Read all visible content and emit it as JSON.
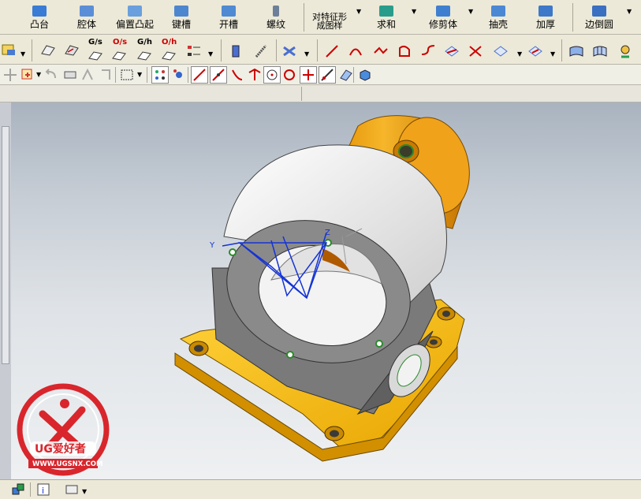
{
  "toolbar_main": {
    "buttons": [
      {
        "label": "凸台",
        "color": "#3a7bd5"
      },
      {
        "label": "腔体",
        "color": "#5a8fd8"
      },
      {
        "label": "偏置凸起",
        "color": "#6aa0de"
      },
      {
        "label": "键槽",
        "color": "#4c86cf"
      },
      {
        "label": "开槽",
        "color": "#4f8ad2"
      },
      {
        "label": "螺纹",
        "color": "#6d7f99"
      },
      {
        "label": "对特征形\n成图样",
        "color": "#2d8a3e"
      },
      {
        "label": "求和",
        "color": "#2a9c8c"
      },
      {
        "label": "修剪体",
        "color": "#3f7fd0"
      },
      {
        "label": "抽壳",
        "color": "#4a88d4"
      },
      {
        "label": "加厚",
        "color": "#3d78c9"
      },
      {
        "label": "边倒圆",
        "color": "#3a6fc2"
      }
    ]
  },
  "toolbar_curves": {
    "tags": [
      "G/s",
      "O/s",
      "G/h",
      "O/h"
    ]
  },
  "model": {
    "axis_y": "Y",
    "axis_z": "Z",
    "colors": {
      "body": "#f2f2f2",
      "frame": "#6e6e6e",
      "base": "#f5b800",
      "cylinder": "#f2a30a",
      "csys": "#1433d6"
    }
  },
  "watermark": {
    "brand": "UG爱好者",
    "url": "WWW.UGSNX.COM",
    "color": "#d8262c"
  }
}
